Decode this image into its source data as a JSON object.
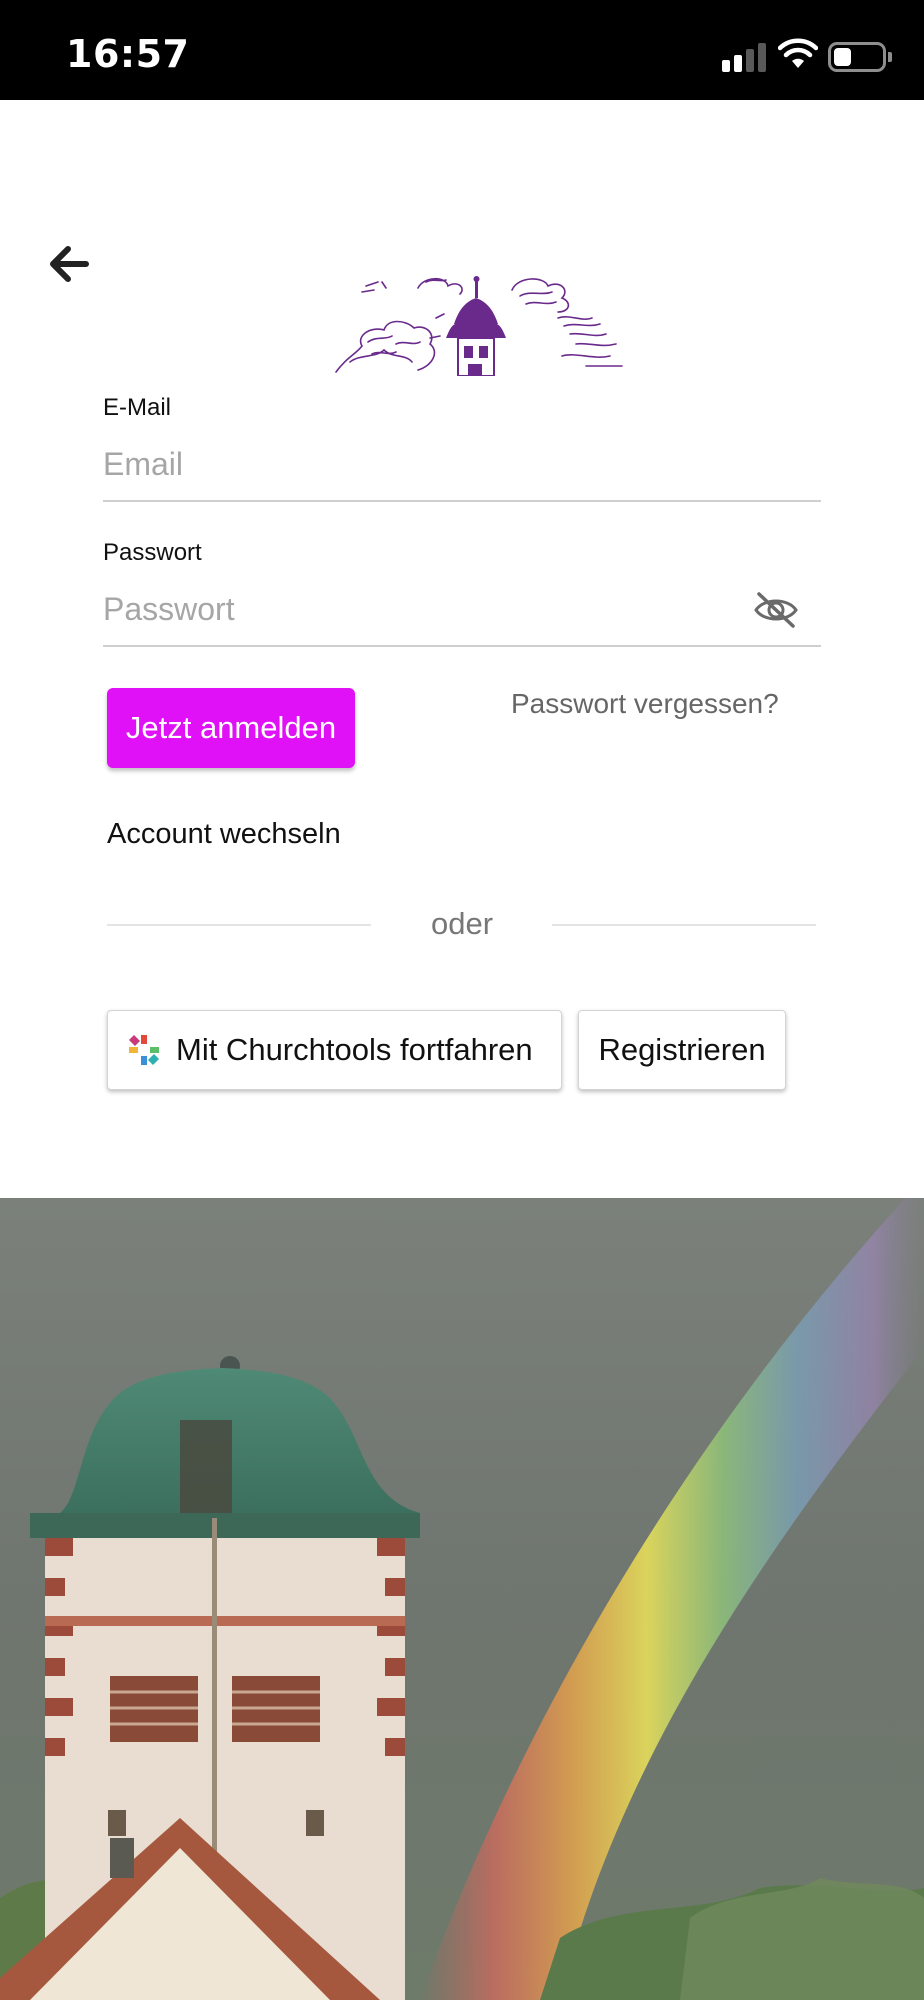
{
  "status_bar": {
    "time": "16:57",
    "battery_level": 0.38
  },
  "header": {
    "back_icon": "arrow-left-icon",
    "logo": "church-tower-logo"
  },
  "form": {
    "email_label": "E-Mail",
    "email_placeholder": "Email",
    "email_value": "",
    "password_label": "Passwort",
    "password_placeholder": "Passwort",
    "password_value": "",
    "visibility_icon": "eye-off-icon"
  },
  "actions": {
    "login_label": "Jetzt anmelden",
    "forgot_label": "Passwort vergessen?",
    "switch_account_label": "Account wechseln",
    "divider_label": "oder",
    "churchtools_label": "Mit Churchtools fortfahren",
    "register_label": "Registrieren"
  },
  "colors": {
    "accent": "#e010f7",
    "logo": "#6a2a8c",
    "status_bar": "#000000"
  }
}
